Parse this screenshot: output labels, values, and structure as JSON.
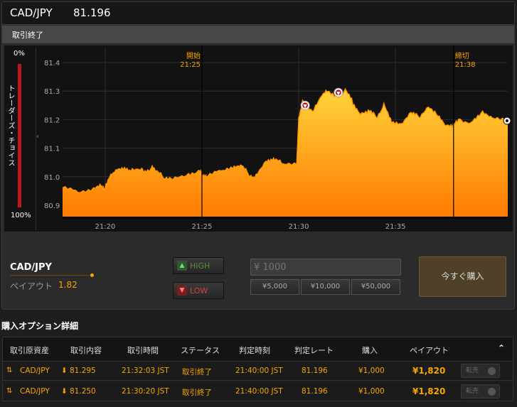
{
  "header": {
    "pair": "CAD/JPY",
    "rate": "81.196"
  },
  "status": "取引終了",
  "trader_choice": {
    "top": "0%",
    "bottom": "100%",
    "label": "トレーダーズ・チョイス"
  },
  "chart_data": {
    "type": "area",
    "y_ticks": [
      "81.4",
      "81.3",
      "81.2",
      "81.1",
      "81.0",
      "80.9"
    ],
    "ylim": [
      80.86,
      81.44
    ],
    "x_ticks": [
      "21:20",
      "21:25",
      "21:30",
      "21:35"
    ],
    "markers": [
      {
        "label": "開始",
        "time": "21:25"
      },
      {
        "label": "締切",
        "time": "21:38"
      }
    ],
    "entry_points": [
      {
        "time": "21:30:20",
        "rate": 81.25
      },
      {
        "time": "21:32:03",
        "rate": 81.295
      }
    ],
    "current_rate": 81.196,
    "colors": {
      "fill_top": "#ffd43a",
      "fill_bottom": "#ff7a00",
      "line": "#ff9800",
      "grid": "#2e2e2e",
      "marker": "#f7a600"
    }
  },
  "trade": {
    "pair": "CAD/JPY",
    "payout_label": "ペイアウト",
    "payout_value": "1.82",
    "high_label": "HIGH",
    "low_label": "LOW",
    "amount_placeholder": "¥ 1000",
    "quick_amounts": [
      "¥5,000",
      "¥10,000",
      "¥50,000"
    ],
    "buy_label": "今すぐ購入"
  },
  "details": {
    "title": "購入オプション詳細",
    "columns": [
      "取引原資産",
      "取引内容",
      "取引時間",
      "ステータス",
      "判定時刻",
      "判定レート",
      "購入",
      "ペイアウト"
    ],
    "collapse_icon": "double-chevron-up-icon",
    "rows": [
      {
        "asset": "CAD/JPY",
        "content": "81.295",
        "time": "21:32:03 JST",
        "status": "取引終了",
        "judge_time": "21:40:00 JST",
        "judge_rate": "81.196",
        "purchase": "¥1,000",
        "payout": "¥1,820",
        "transfer": "転売"
      },
      {
        "asset": "CAD/JPY",
        "content": "81.250",
        "time": "21:30:20 JST",
        "status": "取引終了",
        "judge_time": "21:40:00 JST",
        "judge_rate": "81.196",
        "purchase": "¥1,000",
        "payout": "¥1,820",
        "transfer": "転売"
      }
    ]
  }
}
